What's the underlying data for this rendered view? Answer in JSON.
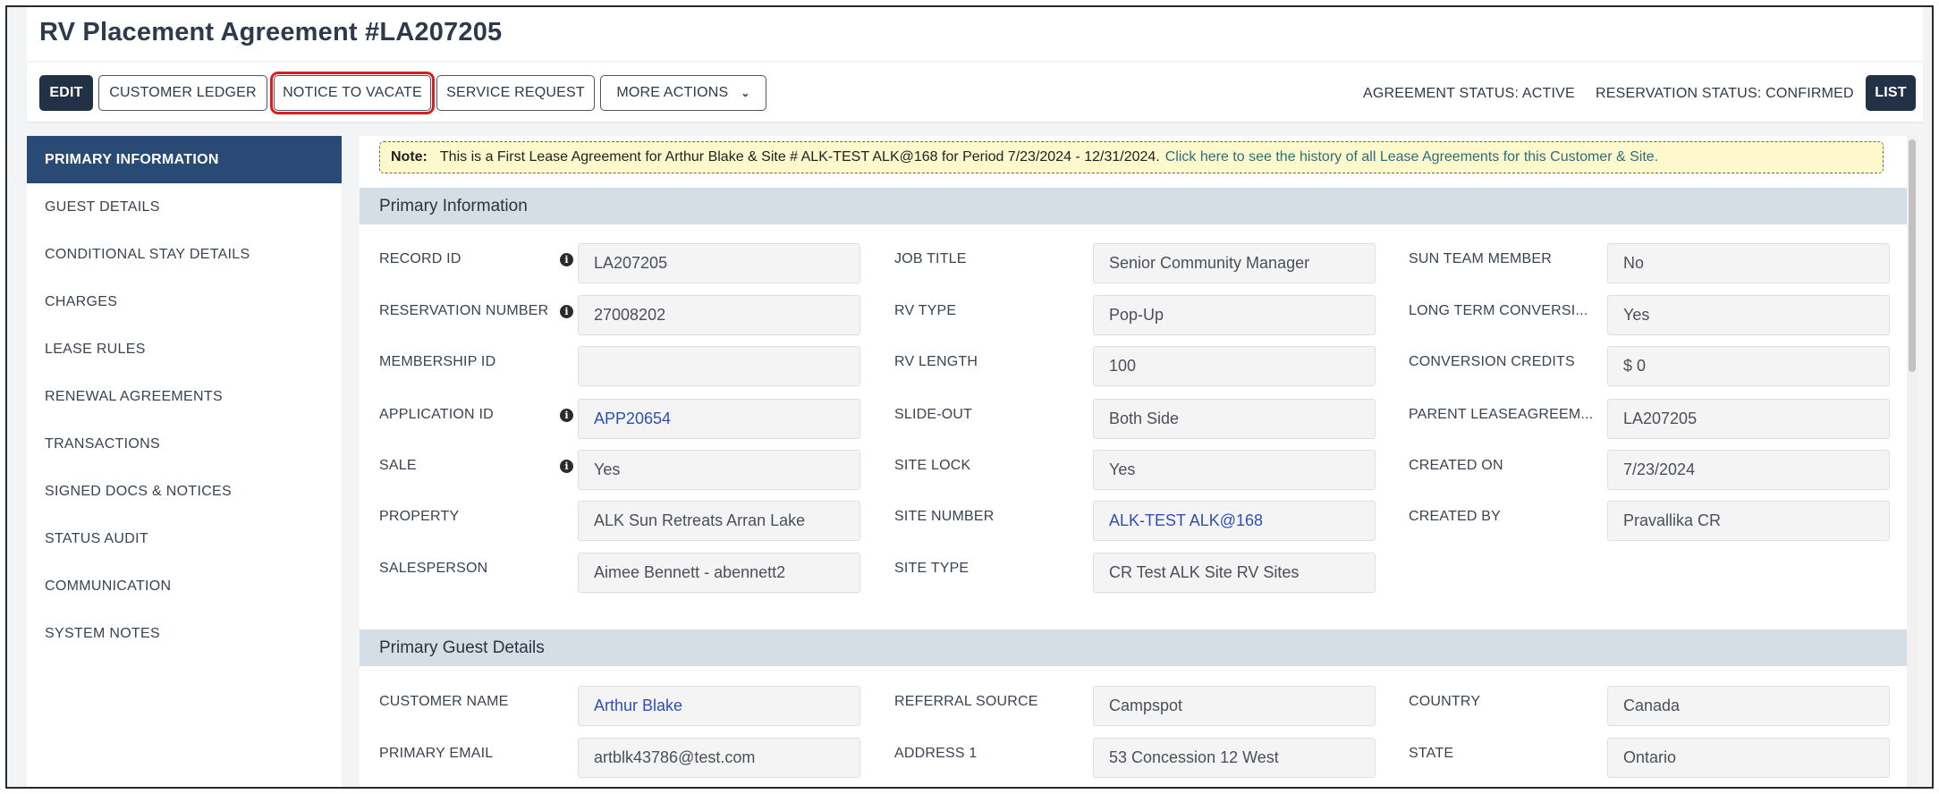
{
  "title": "RV Placement Agreement #LA207205",
  "toolbar": {
    "edit": "EDIT",
    "customer_ledger": "CUSTOMER LEDGER",
    "notice_to_vacate": "NOTICE TO VACATE",
    "service_request": "SERVICE REQUEST",
    "more_actions": "MORE ACTIONS",
    "agreement_status": "AGREEMENT STATUS: ACTIVE",
    "reservation_status": "RESERVATION STATUS: CONFIRMED",
    "list": "LIST"
  },
  "sidebar": {
    "items": [
      {
        "label": "PRIMARY INFORMATION"
      },
      {
        "label": "GUEST DETAILS"
      },
      {
        "label": "CONDITIONAL STAY DETAILS"
      },
      {
        "label": "CHARGES"
      },
      {
        "label": "LEASE RULES"
      },
      {
        "label": "RENEWAL AGREEMENTS"
      },
      {
        "label": "TRANSACTIONS"
      },
      {
        "label": "SIGNED DOCS & NOTICES"
      },
      {
        "label": "STATUS AUDIT"
      },
      {
        "label": "COMMUNICATION"
      },
      {
        "label": "SYSTEM NOTES"
      }
    ]
  },
  "note": {
    "label": "Note:",
    "text": "This is a First Lease Agreement for Arthur Blake & Site # ALK-TEST ALK@168 for Period 7/23/2024 - 12/31/2024.",
    "link": "Click here to see the history of all Lease Agreements for this Customer & Site."
  },
  "primary": {
    "header": "Primary Information",
    "col1": [
      {
        "label": "RECORD ID",
        "value": "LA207205"
      },
      {
        "label": "RESERVATION NUMBER",
        "value": "27008202"
      },
      {
        "label": "MEMBERSHIP ID",
        "value": ""
      },
      {
        "label": "APPLICATION ID",
        "value": "APP20654"
      },
      {
        "label": "SALE",
        "value": "Yes"
      },
      {
        "label": "PROPERTY",
        "value": "ALK Sun Retreats Arran Lake"
      },
      {
        "label": "SALESPERSON",
        "value": "Aimee Bennett - abennett2"
      }
    ],
    "col2": [
      {
        "label": "JOB TITLE",
        "value": "Senior Community Manager"
      },
      {
        "label": "RV TYPE",
        "value": "Pop-Up"
      },
      {
        "label": "RV LENGTH",
        "value": "100"
      },
      {
        "label": "SLIDE-OUT",
        "value": "Both Side"
      },
      {
        "label": "SITE LOCK",
        "value": "Yes"
      },
      {
        "label": "SITE NUMBER",
        "value": "ALK-TEST ALK@168"
      },
      {
        "label": "SITE TYPE",
        "value": "CR Test ALK Site RV Sites"
      }
    ],
    "col3": [
      {
        "label": "SUN TEAM MEMBER",
        "value": "No"
      },
      {
        "label": "LONG TERM CONVERSI...",
        "value": "Yes"
      },
      {
        "label": "CONVERSION CREDITS",
        "value": "$ 0"
      },
      {
        "label": "PARENT LEASEAGREEM...",
        "value": "LA207205"
      },
      {
        "label": "CREATED ON",
        "value": "7/23/2024"
      },
      {
        "label": "CREATED BY",
        "value": "Pravallika CR"
      }
    ]
  },
  "guest": {
    "header": "Primary Guest Details",
    "col1": [
      {
        "label": "CUSTOMER NAME",
        "value": "Arthur Blake"
      },
      {
        "label": "PRIMARY EMAIL",
        "value": "artblk43786@test.com"
      }
    ],
    "col2": [
      {
        "label": "REFERRAL SOURCE",
        "value": "Campspot"
      },
      {
        "label": "ADDRESS 1",
        "value": "53 Concession 12 West"
      }
    ],
    "col3": [
      {
        "label": "COUNTRY",
        "value": "Canada"
      },
      {
        "label": "STATE",
        "value": "Ontario"
      }
    ]
  },
  "icons": {
    "info": "info-icon",
    "chevron": "chevron-down-icon"
  },
  "colors": {
    "primary_dark": "#233146",
    "sidebar_active": "#284a74",
    "section_header": "#d6dee5",
    "link": "#2d4fb8",
    "note_bg": "#fdf9cc",
    "highlight": "#d72020"
  }
}
